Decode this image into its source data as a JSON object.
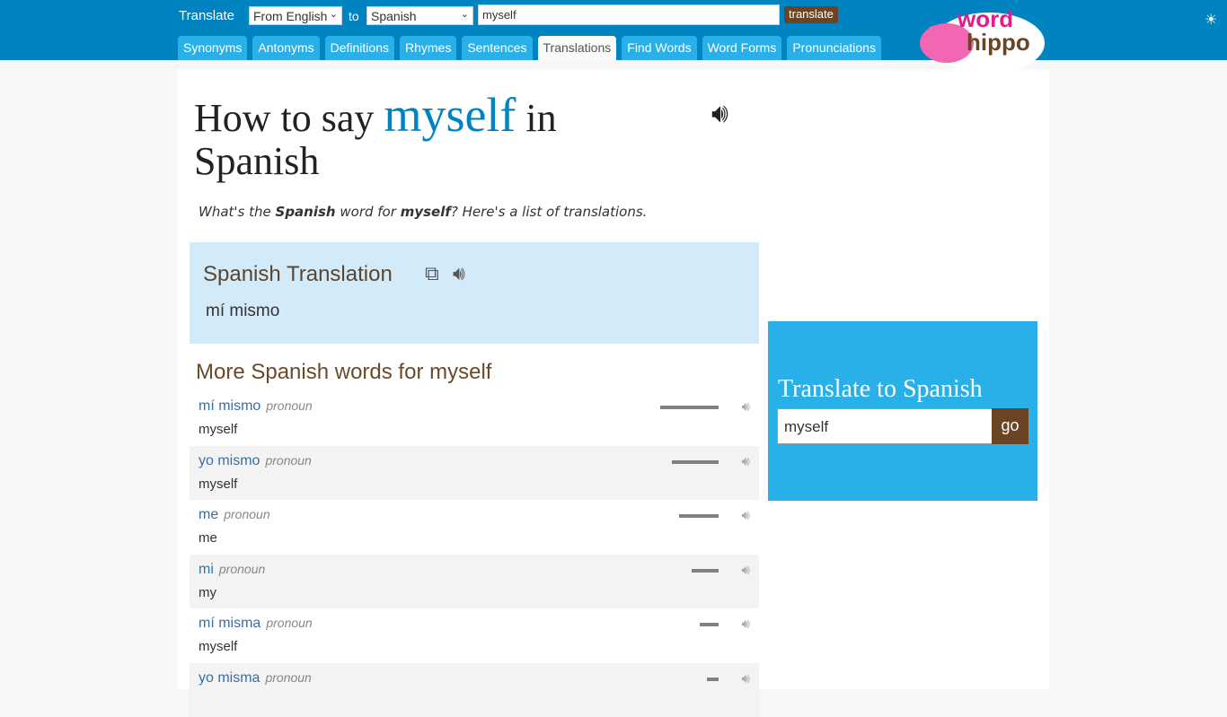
{
  "header": {
    "translate_label": "Translate",
    "from_select": "From English",
    "to_label": "to",
    "to_select": "Spanish",
    "query": "myself",
    "translate_button": "translate",
    "tabs": [
      "Synonyms",
      "Antonyms",
      "Definitions",
      "Rhymes",
      "Sentences",
      "Translations",
      "Find Words",
      "Word Forms",
      "Pronunciations"
    ],
    "active_tab": "Translations",
    "logo_text": "word hippo"
  },
  "title": {
    "pre": "How to say ",
    "word": "myself",
    "post": " in Spanish"
  },
  "subtitle": {
    "a": "What's the ",
    "b": "Spanish",
    "c": " word for ",
    "d": "myself",
    "e": "? Here's a list of translations."
  },
  "translation_box": {
    "heading": "Spanish Translation",
    "value": "mí mismo"
  },
  "more_heading": "More Spanish words for myself",
  "words": [
    {
      "word": "mí mismo",
      "pos": "pronoun",
      "meaning": "myself",
      "frequency": 1.0
    },
    {
      "word": "yo mismo",
      "pos": "pronoun",
      "meaning": "myself",
      "frequency": 0.8
    },
    {
      "word": "me",
      "pos": "pronoun",
      "meaning": "me",
      "frequency": 0.67
    },
    {
      "word": "mi",
      "pos": "pronoun",
      "meaning": "my",
      "frequency": 0.46
    },
    {
      "word": "mí misma",
      "pos": "pronoun",
      "meaning": "myself",
      "frequency": 0.33
    },
    {
      "word": "yo misma",
      "pos": "pronoun",
      "meaning": "",
      "frequency": 0.2
    }
  ],
  "sidebar": {
    "heading": "Translate to Spanish",
    "input": "myself",
    "go": "go"
  },
  "colors": {
    "header": "#0083c1",
    "tab": "#2ab0e8",
    "button": "#6b4423",
    "box": "#d3ebf9"
  }
}
